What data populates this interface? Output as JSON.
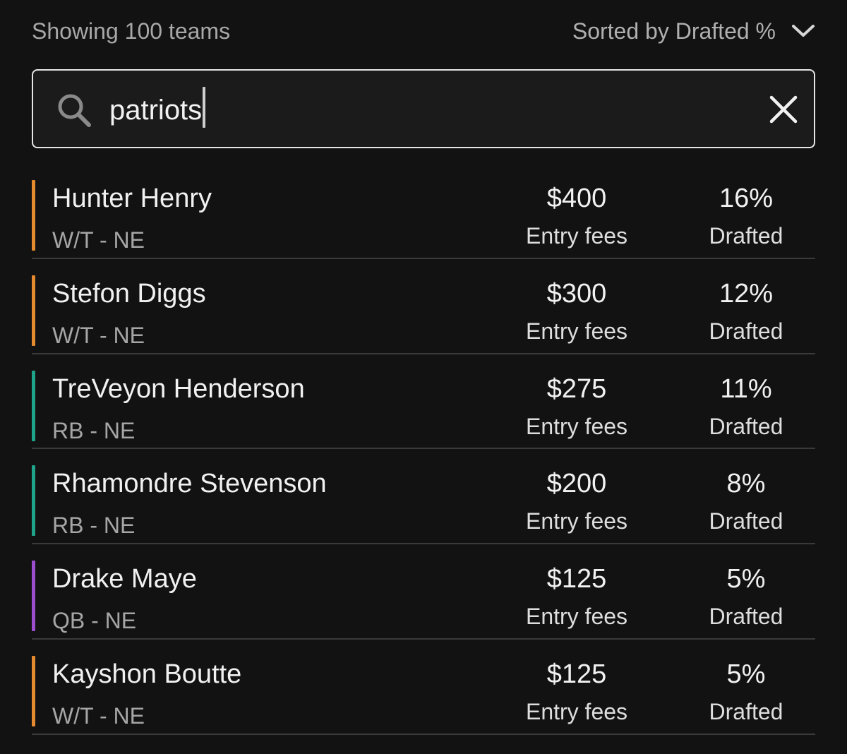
{
  "header": {
    "count_text": "Showing 100 teams",
    "sort_label": "Sorted by Drafted %"
  },
  "search": {
    "value": "patriots"
  },
  "colors": {
    "wr_te": "#e58a2e",
    "rb": "#1fa38a",
    "qb": "#9b4fd0"
  },
  "players": [
    {
      "name": "Hunter Henry",
      "position": "W/T - NE",
      "group": "wr_te",
      "fee": "$400",
      "fee_label": "Entry fees",
      "pct": "16%",
      "pct_label": "Drafted"
    },
    {
      "name": "Stefon Diggs",
      "position": "W/T - NE",
      "group": "wr_te",
      "fee": "$300",
      "fee_label": "Entry fees",
      "pct": "12%",
      "pct_label": "Drafted"
    },
    {
      "name": "TreVeyon Henderson",
      "position": "RB - NE",
      "group": "rb",
      "fee": "$275",
      "fee_label": "Entry fees",
      "pct": "11%",
      "pct_label": "Drafted"
    },
    {
      "name": "Rhamondre Stevenson",
      "position": "RB - NE",
      "group": "rb",
      "fee": "$200",
      "fee_label": "Entry fees",
      "pct": "8%",
      "pct_label": "Drafted"
    },
    {
      "name": "Drake Maye",
      "position": "QB - NE",
      "group": "qb",
      "fee": "$125",
      "fee_label": "Entry fees",
      "pct": "5%",
      "pct_label": "Drafted"
    },
    {
      "name": "Kayshon Boutte",
      "position": "W/T - NE",
      "group": "wr_te",
      "fee": "$125",
      "fee_label": "Entry fees",
      "pct": "5%",
      "pct_label": "Drafted"
    }
  ]
}
